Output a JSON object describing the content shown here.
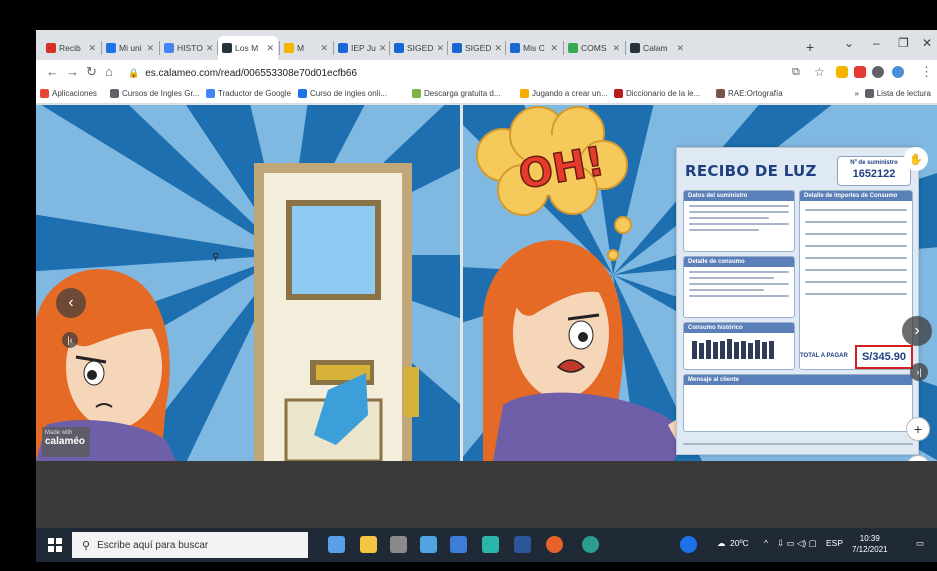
{
  "browser": {
    "tabs": [
      {
        "label": "Recib",
        "favicon": "gmail-icon",
        "color": "#d93025"
      },
      {
        "label": "Mi uni",
        "favicon": "drive-icon",
        "color": "#1a73e8"
      },
      {
        "label": "HISTO",
        "favicon": "doc-icon",
        "color": "#4285f4"
      },
      {
        "label": "Los M",
        "favicon": "calameo-icon",
        "color": "#263238",
        "active": true
      },
      {
        "label": "M",
        "favicon": "slides-icon",
        "color": "#f4b400"
      },
      {
        "label": "IEP Ju",
        "favicon": "classroom-icon",
        "color": "#1967d2"
      },
      {
        "label": "SIGED",
        "favicon": "siged-icon",
        "color": "#1967d2"
      },
      {
        "label": "SIGED",
        "favicon": "siged-icon",
        "color": "#1967d2"
      },
      {
        "label": "Mis C",
        "favicon": "classroom-icon",
        "color": "#1967d2"
      },
      {
        "label": "COMS",
        "favicon": "chrome-icon",
        "color": "#34a853"
      },
      {
        "label": "Calam",
        "favicon": "calameo-icon",
        "color": "#263238"
      }
    ],
    "new_tab": "+",
    "window_controls": {
      "dropdown": "⌄",
      "minimize": "–",
      "restore": "❐",
      "close": "✕"
    },
    "url": "es.calameo.com/read/006553308e70d01ecfb66"
  },
  "bookmarks": [
    {
      "label": "Aplicaciones",
      "icon": "apps-grid-icon",
      "color": "#ea4335"
    },
    {
      "label": "Cursos de Ingles Gr...",
      "icon": "globe-icon",
      "color": "#5f6368"
    },
    {
      "label": "Traductor de Google",
      "icon": "translate-icon",
      "color": "#4285f4"
    },
    {
      "label": "Curso de ingles onli...",
      "icon": "site-icon",
      "color": "#1a73e8"
    },
    {
      "label": "Descarga gratuita d...",
      "icon": "leaf-icon",
      "color": "#7cb342"
    },
    {
      "label": "Jugando a crear un...",
      "icon": "site-icon",
      "color": "#f9ab00"
    },
    {
      "label": "Diccionario de la le...",
      "icon": "rae-icon",
      "color": "#b71c1c"
    },
    {
      "label": "RAE:Ortografía",
      "icon": "rae-icon",
      "color": "#795548"
    }
  ],
  "bookmarks_overflow": "»",
  "reading_list": "Lista de lectura",
  "viewer": {
    "comic_text": "OH!",
    "receipt": {
      "title": "RECIBO DE LUZ",
      "supply_label": "Nº de suministro",
      "supply_number": "1652122",
      "sections": {
        "supply_data": "Datos del suministro",
        "consumption": "Detalle de consumo",
        "history": "Consumo histórico",
        "charges": "Detalle de importes de Consumo",
        "message": "Mensaje al cliente"
      },
      "total_label": "TOTAL A PAGAR",
      "total_value": "S/345.90"
    },
    "made_with_label": "Made with",
    "made_with_brand": "calaméo",
    "zoom_in": "+",
    "zoom_out": "−"
  },
  "taskbar": {
    "search_placeholder": "Escribe aquí para buscar",
    "weather": "20ºC",
    "language": "ESP",
    "time": "10:39",
    "date": "7/12/2021"
  }
}
